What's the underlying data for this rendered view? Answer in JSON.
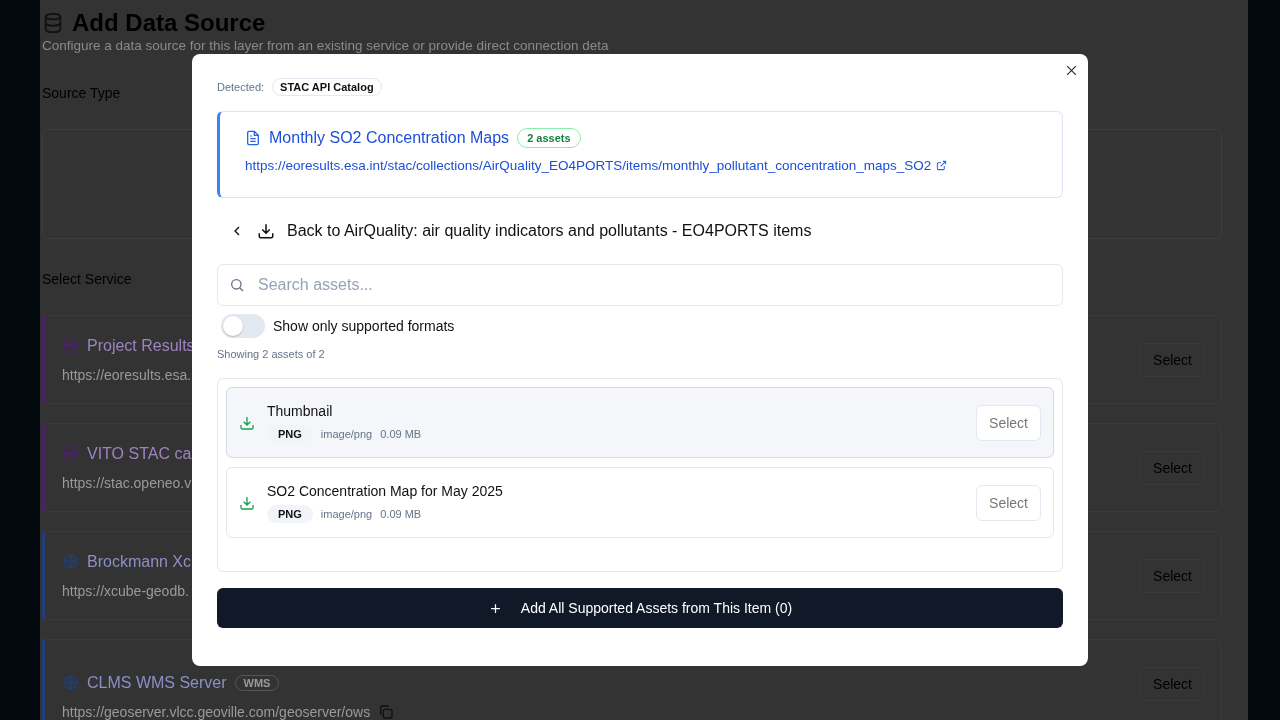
{
  "page": {
    "title": "Add Data Source",
    "subtitle": "Configure a data source for this layer from an existing service or provide direct connection deta",
    "source_type_label": "Source Type",
    "service_label": "Select Service",
    "services": [
      {
        "kind": "server",
        "name": "Project Results",
        "url": "https://eoresults.esa.",
        "color": "#4a2266",
        "button": "Select"
      },
      {
        "kind": "server",
        "name": "VITO STAC ca",
        "url": "https://stac.openeo.v",
        "color": "#4a2266",
        "button": "Select"
      },
      {
        "kind": "globe",
        "name": "Brockmann Xc",
        "url": "https://xcube-geodb.",
        "color": "#203f7a",
        "button": "Select"
      },
      {
        "kind": "globe",
        "name": "CLMS WMS Server",
        "badge": "WMS",
        "url": "https://geoserver.vlcc.geoville.com/geoserver/ows",
        "copy": true,
        "color": "#203f7a",
        "button": "Select"
      }
    ]
  },
  "dialog": {
    "detected_label": "Detected:",
    "detected_value": "STAC API Catalog",
    "item": {
      "title": "Monthly SO2 Concentration Maps",
      "badge": "2 assets",
      "url": "https://eoresults.esa.int/stac/collections/AirQuality_EO4PORTS/items/monthly_pollutant_concentration_maps_SO2"
    },
    "back_label": "Back to AirQuality: air quality indicators and pollutants - EO4PORTS items",
    "search": {
      "placeholder": "Search assets..."
    },
    "toggle": {
      "label": "Show only supported formats",
      "on": false
    },
    "count_text": "Showing 2 assets of 2",
    "assets": [
      {
        "title": "Thumbnail",
        "format": "PNG",
        "mime": "image/png",
        "size": "0.09 MB",
        "button": "Select",
        "selected": true
      },
      {
        "title": "SO2 Concentration Map for May 2025",
        "format": "PNG",
        "mime": "image/png",
        "size": "0.09 MB",
        "button": "Select",
        "selected": false
      }
    ],
    "add_button": "Add All Supported Assets from This Item (0)"
  }
}
